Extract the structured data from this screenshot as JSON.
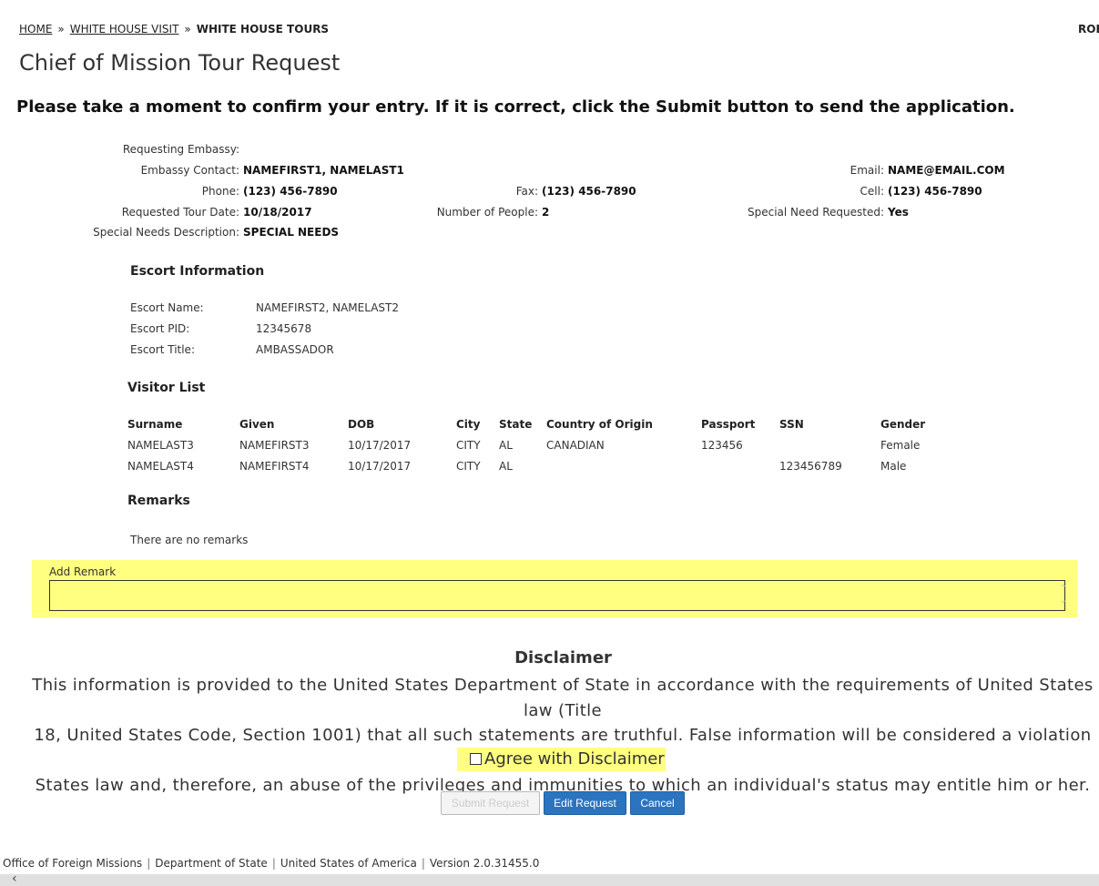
{
  "breadcrumb": {
    "home": "HOME",
    "sep": "»",
    "visit": "WHITE HOUSE VISIT",
    "current": "WHITE HOUSE TOURS"
  },
  "user_label": "ROB",
  "page_title": "Chief of Mission Tour Request",
  "confirm_message": "Please take a moment to confirm your entry. If it is correct, click the Submit button to send the application.",
  "request": {
    "requesting_embassy_label": "Requesting Embassy:",
    "requesting_embassy_value": "",
    "embassy_contact_label": "Embassy Contact:",
    "embassy_contact_value": "NAMEFIRST1, NAMELAST1",
    "email_label": "Email:",
    "email_value": "NAME@EMAIL.COM",
    "phone_label": "Phone:",
    "phone_value": "(123) 456-7890",
    "fax_label": "Fax:",
    "fax_value": "(123) 456-7890",
    "cell_label": "Cell:",
    "cell_value": "(123) 456-7890",
    "tour_date_label": "Requested Tour Date:",
    "tour_date_value": "10/18/2017",
    "num_people_label": "Number of People:",
    "num_people_value": "2",
    "special_need_label": "Special Need Requested:",
    "special_need_value": "Yes",
    "special_desc_label": "Special Needs Description:",
    "special_desc_value": "SPECIAL NEEDS"
  },
  "escort": {
    "heading": "Escort Information",
    "name_label": "Escort Name:",
    "name_value": "NAMEFIRST2, NAMELAST2",
    "pid_label": "Escort PID:",
    "pid_value": "12345678",
    "title_label": "Escort Title:",
    "title_value": "AMBASSADOR"
  },
  "visitors": {
    "heading": "Visitor List",
    "columns": [
      "Surname",
      "Given",
      "DOB",
      "City",
      "State",
      "Country of Origin",
      "Passport",
      "SSN",
      "Gender"
    ],
    "rows": [
      [
        "NAMELAST3",
        "NAMEFIRST3",
        "10/17/2017",
        "CITY",
        "AL",
        "CANADIAN",
        "123456",
        "",
        "Female"
      ],
      [
        "NAMELAST4",
        "NAMEFIRST4",
        "10/17/2017",
        "CITY",
        "AL",
        "",
        "",
        "123456789",
        "Male"
      ]
    ]
  },
  "remarks": {
    "heading": "Remarks",
    "empty_text": "There are no remarks",
    "add_label": "Add Remark",
    "add_value": ""
  },
  "disclaimer": {
    "title": "Disclaimer",
    "line1": "This information is provided to the United States Department of State in accordance with the requirements of United States law (Title",
    "line2": "18, United States Code, Section 1001) that all such statements are truthful. False information will be considered a violation of United",
    "line3": "States law and, therefore, an abuse of the privileges and immunities to which an individual's status may entitle him or her.",
    "agree_label": "Agree with Disclaimer",
    "agree_checked": false
  },
  "buttons": {
    "submit": "Submit Request",
    "edit": "Edit Request",
    "cancel": "Cancel"
  },
  "footer": {
    "office": "Office of Foreign Missions",
    "dept": "Department of State",
    "country": "United States of America",
    "version": "Version 2.0.31455.0"
  },
  "colors": {
    "highlight": "#ffff80",
    "primary_button": "#2b74c0"
  }
}
